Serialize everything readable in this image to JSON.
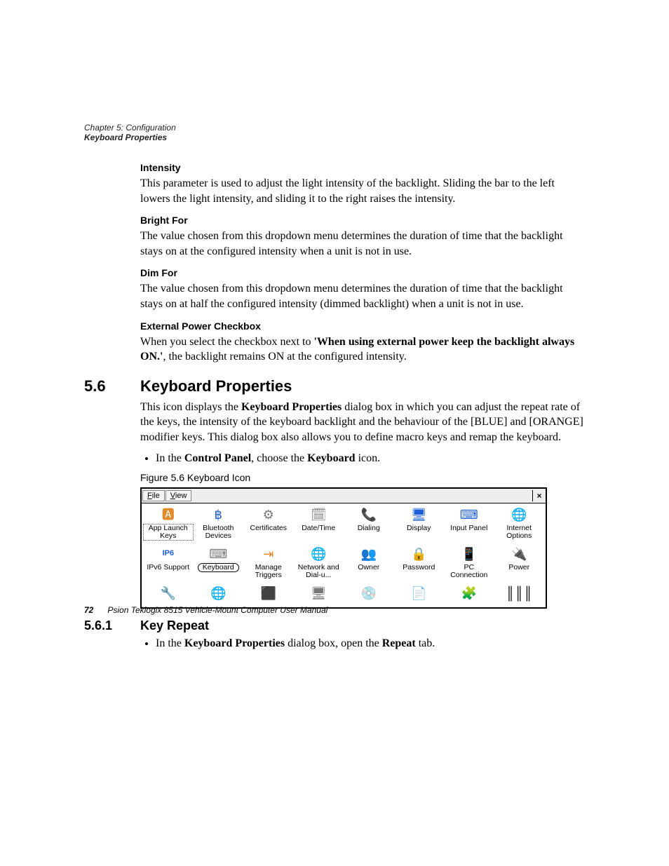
{
  "header": {
    "chapter": "Chapter 5: Configuration",
    "section": "Keyboard Properties"
  },
  "intensity": {
    "heading": "Intensity",
    "text": "This parameter is used to adjust the light intensity of the backlight. Sliding the bar to the left lowers the light intensity, and sliding it to the right raises the intensity."
  },
  "bright_for": {
    "heading": "Bright For",
    "text": "The value chosen from this dropdown menu determines the duration of time that the backlight stays on at the configured intensity when a unit is not in use."
  },
  "dim_for": {
    "heading": "Dim For",
    "text": "The value chosen from this dropdown menu determines the duration of time that the backlight stays on at half the configured intensity (dimmed backlight) when a unit is not in use."
  },
  "ext_power": {
    "heading": "External Power Checkbox",
    "prefix": "When you select the checkbox next to ",
    "bold": "'When using external power keep the backlight always ON.'",
    "suffix": ", the backlight remains ON at the configured intensity."
  },
  "sec56": {
    "num": "5.6",
    "title": "Keyboard Properties",
    "para_a": "This icon displays the ",
    "para_b_bold": "Keyboard Properties",
    "para_c": " dialog box in which you can adjust the repeat rate of the keys, the intensity of the keyboard backlight and the behaviour of the [BLUE] and [ORANGE] modifier keys. This dialog box also allows you to define macro keys and remap the keyboard.",
    "bullet_a": "In the ",
    "bullet_b_bold": "Control Panel",
    "bullet_c": ", choose the ",
    "bullet_d_bold": "Keyboard",
    "bullet_e": " icon.",
    "fig_caption": "Figure 5.6  Keyboard Icon"
  },
  "dialog": {
    "menu": {
      "file": "File",
      "view": "View",
      "close": "×"
    },
    "row1": [
      {
        "label": "App Launch Keys",
        "glyph": "🅰",
        "cls": "c-orange",
        "boxed": true
      },
      {
        "label": "Bluetooth Devices",
        "glyph": "฿",
        "cls": "c-blue"
      },
      {
        "label": "Certificates",
        "glyph": "⚙",
        "cls": "c-gray"
      },
      {
        "label": "Date/Time",
        "glyph": "🗓",
        "cls": "c-gray"
      },
      {
        "label": "Dialing",
        "glyph": "📞",
        "cls": "c-green"
      },
      {
        "label": "Display",
        "glyph": "🖥",
        "cls": "c-blue"
      },
      {
        "label": "Input Panel",
        "glyph": "⌨",
        "cls": "c-blue"
      },
      {
        "label": "Internet Options",
        "glyph": "🌐",
        "cls": "c-green"
      }
    ],
    "row2": [
      {
        "label": "IPv6 Support",
        "glyph": "IP6",
        "cls": "c-blue"
      },
      {
        "label": "Keyboard",
        "glyph": "⌨",
        "cls": "c-gray",
        "selected": true
      },
      {
        "label": "Manage Triggers",
        "glyph": "⇥",
        "cls": "c-orange"
      },
      {
        "label": "Network and Dial-u...",
        "glyph": "🌐",
        "cls": "c-green"
      },
      {
        "label": "Owner",
        "glyph": "👥",
        "cls": "c-orange"
      },
      {
        "label": "Password",
        "glyph": "🔒",
        "cls": "c-orange"
      },
      {
        "label": "PC Connection",
        "glyph": "📱",
        "cls": "c-red"
      },
      {
        "label": "Power",
        "glyph": "🔌",
        "cls": "c-blue"
      }
    ],
    "row3": [
      {
        "label": "",
        "glyph": "🔧",
        "cls": "c-blue"
      },
      {
        "label": "",
        "glyph": "🌐",
        "cls": "c-green"
      },
      {
        "label": "",
        "glyph": "⬛",
        "cls": "c-orange"
      },
      {
        "label": "",
        "glyph": "🖥",
        "cls": "c-gray"
      },
      {
        "label": "",
        "glyph": "💿",
        "cls": "c-blue"
      },
      {
        "label": "",
        "glyph": "📄",
        "cls": "c-orange"
      },
      {
        "label": "",
        "glyph": "🧩",
        "cls": "c-red"
      },
      {
        "label": "",
        "glyph": "║║║",
        "cls": ""
      }
    ]
  },
  "sec561": {
    "num": "5.6.1",
    "title": "Key Repeat",
    "bullet_a": "In the ",
    "bullet_b_bold": "Keyboard Properties",
    "bullet_c": " dialog box, open the ",
    "bullet_d_bold": "Repeat",
    "bullet_e": " tab."
  },
  "footer": {
    "page": "72",
    "title": "Psion Teklogix 8515 Vehicle-Mount Computer User Manual"
  }
}
